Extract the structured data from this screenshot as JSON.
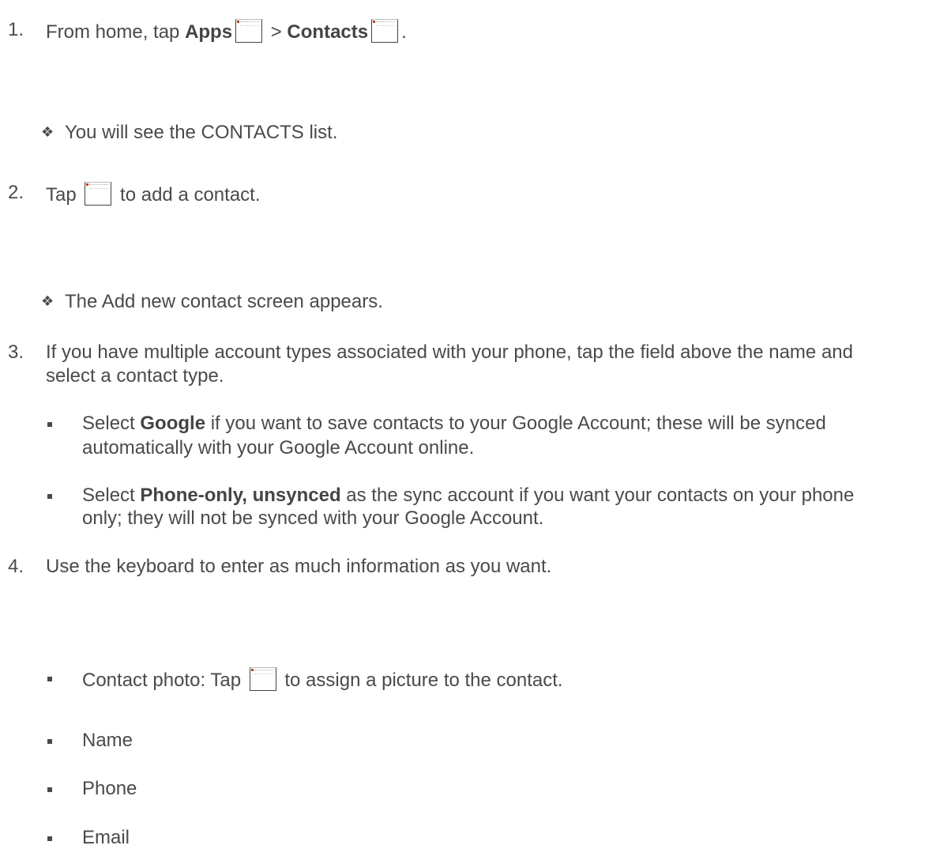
{
  "steps": [
    {
      "number": "1.",
      "prefix": "From home, tap ",
      "bold1": "Apps",
      "sep": " > ",
      "bold2": "Contacts",
      "suffix": ".",
      "icon1": "apps-icon",
      "icon2": "contacts-icon"
    },
    {
      "number": "2.",
      "prefix": "Tap ",
      "suffix": " to add a contact.",
      "icon": "add-contact-icon"
    },
    {
      "number": "3.",
      "line1": "If you have multiple account types associated with your phone, tap the field above the name and",
      "line2": "select a contact type."
    },
    {
      "number": "4.",
      "text": "Use the keyboard to enter as much information as you want."
    }
  ],
  "notes": [
    "You will see the CONTACTS list.",
    "The Add new contact screen appears."
  ],
  "sync_options": [
    {
      "prefix": "Select ",
      "bold": "Google",
      "line1_rest": " if you want to save contacts to your Google Account; these will be synced",
      "line2": "automatically with your Google Account online."
    },
    {
      "prefix": "Select ",
      "bold": "Phone-only, unsynced",
      "line1_rest": " as the sync account if you want your contacts on your phone",
      "line2": "only; they will not be synced with your Google Account."
    }
  ],
  "fields": {
    "photo_prefix": "Contact photo: Tap ",
    "photo_suffix": " to assign a picture to the contact.",
    "photo_icon": "contact-photo-icon",
    "items": [
      "Name",
      "Phone",
      "Email"
    ]
  },
  "bullet_glyph": "❖"
}
